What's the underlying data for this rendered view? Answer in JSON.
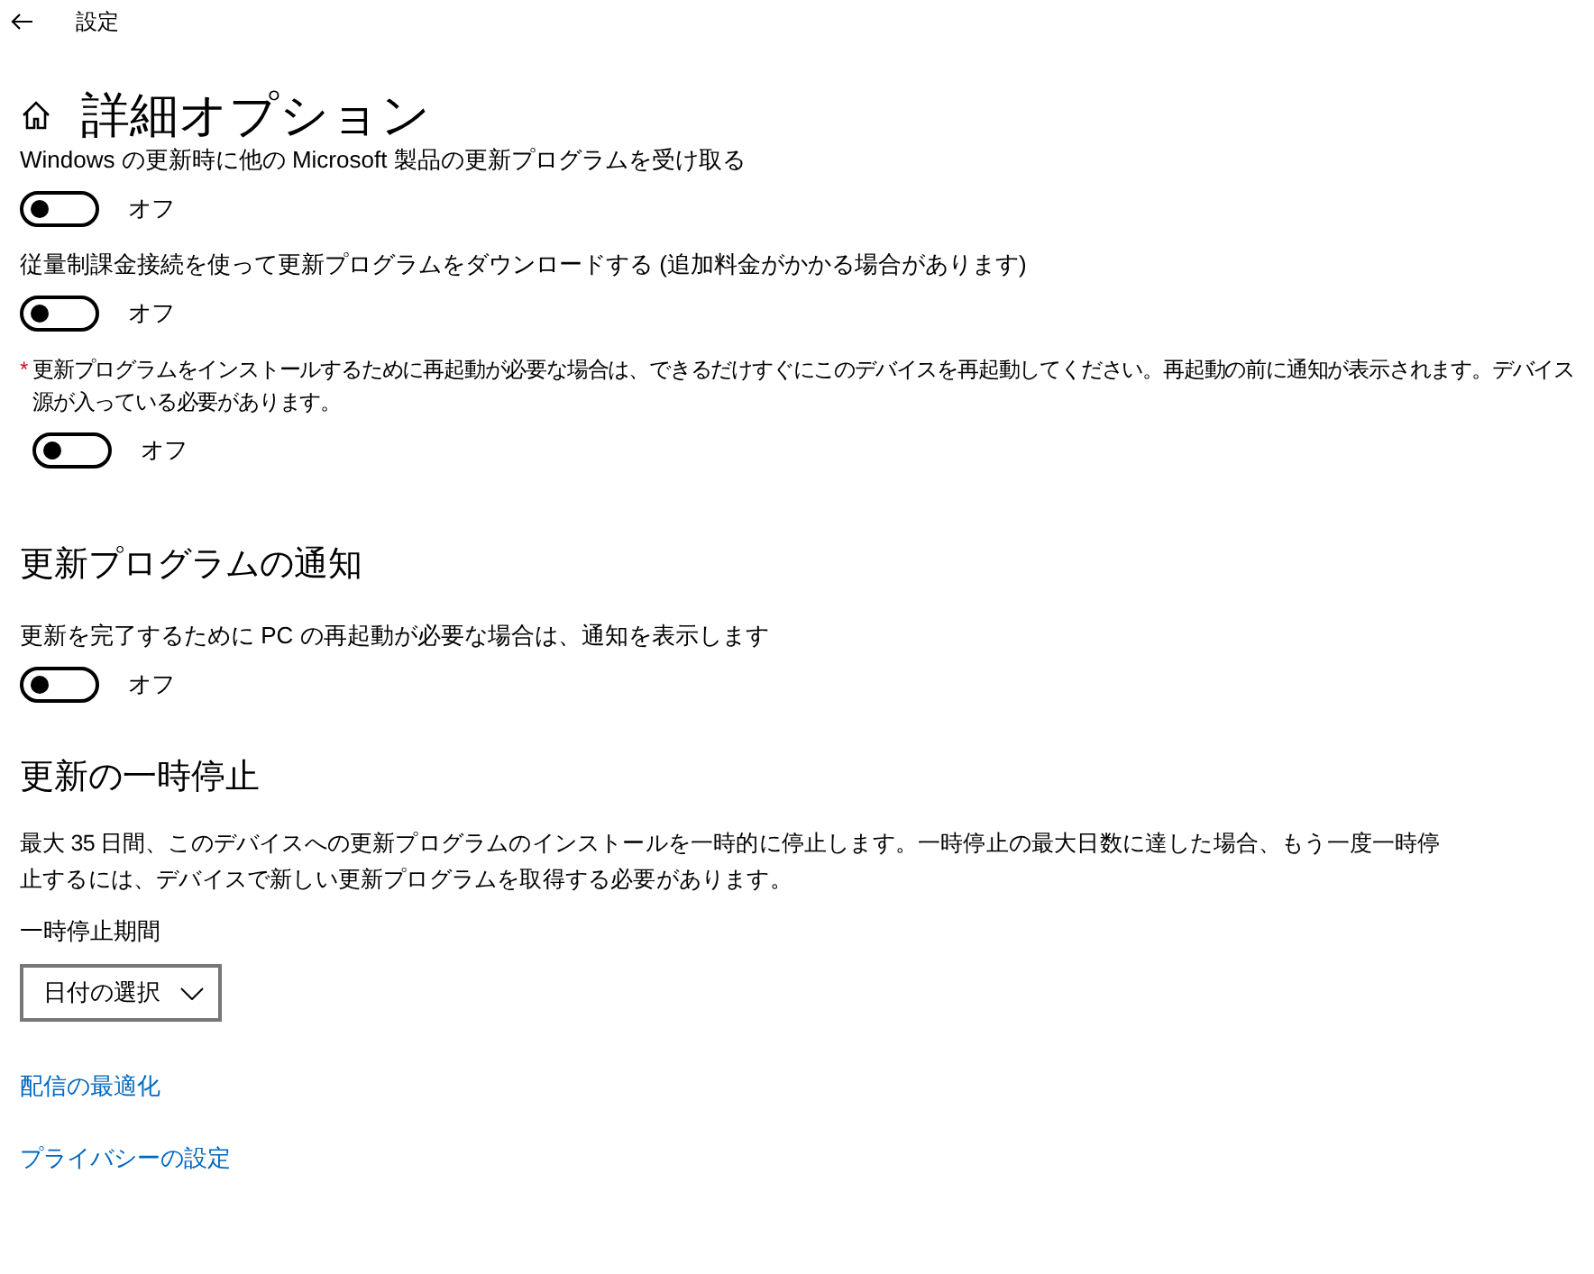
{
  "window": {
    "title": "設定"
  },
  "page": {
    "title": "詳細オプション"
  },
  "options": [
    {
      "kind": "plain",
      "lines": [
        "Windows の更新時に他の Microsoft 製品の更新プログラムを受け取る"
      ],
      "on": false,
      "state_label": "オフ"
    },
    {
      "kind": "plain",
      "lines": [
        "従量制課金接続を使って更新プログラムをダウンロードする (追加料金がかかる場合があります)"
      ],
      "on": false,
      "state_label": "オフ"
    },
    {
      "kind": "starred",
      "marker": "*",
      "lines": [
        "更新プログラムをインストールするために再起動が必要な場合は、できるだけすぐにこのデバイスを再起動してください。再起動の前に通知が表示されます。デバイス",
        "源が入っている必要があります。"
      ],
      "on": false,
      "state_label": "オフ"
    }
  ],
  "notifications": {
    "heading": "更新プログラムの通知",
    "description": "更新を完了するために PC の再起動が必要な場合は、通知を表示します",
    "on": false,
    "state_label": "オフ"
  },
  "pause": {
    "heading": "更新の一時停止",
    "description": "最大 35 日間、このデバイスへの更新プログラムのインストールを一時的に停止します。一時停止の最大日数に達した場合、もう一度一時停止するには、デバイスで新しい更新プログラムを取得する必要があります。",
    "field_label": "一時停止期間",
    "dropdown": "日付の選択"
  },
  "links": [
    "配信の最適化",
    "プライバシーの設定"
  ]
}
